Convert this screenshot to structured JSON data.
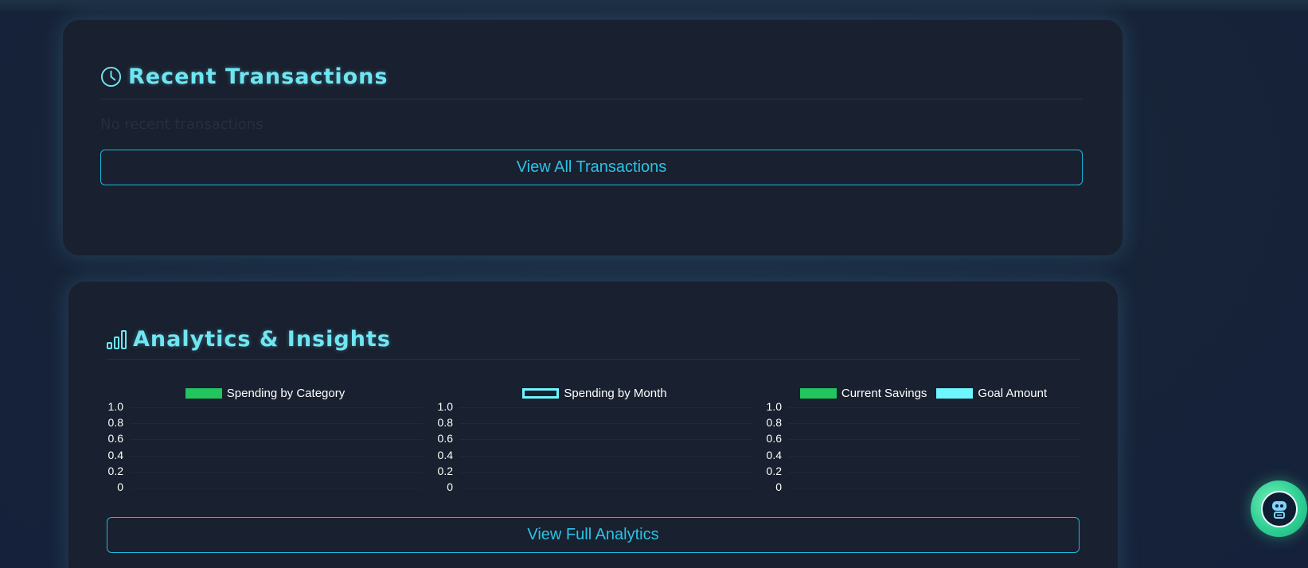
{
  "transactions": {
    "title": "Recent Transactions",
    "icon": "clock-icon",
    "empty_text": "No recent transactions",
    "view_all_label": "View All Transactions"
  },
  "analytics": {
    "title": "Analytics & Insights",
    "icon": "bar-chart-icon",
    "view_full_label": "View Full Analytics"
  },
  "colors": {
    "accent_title": "#6fe6f2",
    "button_border": "#1fb8d8",
    "green": "#22c55e",
    "cyan": "#6ef6ff"
  },
  "chart_data": [
    {
      "type": "bar",
      "series": [
        {
          "name": "Spending by Category",
          "values": []
        }
      ],
      "categories": [],
      "yticks": [
        "1.0",
        "0.8",
        "0.6",
        "0.4",
        "0.2",
        "0"
      ],
      "ylim": [
        0,
        1
      ],
      "legend": "top-center"
    },
    {
      "type": "line",
      "series": [
        {
          "name": "Spending by Month",
          "values": []
        }
      ],
      "categories": [],
      "yticks": [
        "1.0",
        "0.8",
        "0.6",
        "0.4",
        "0.2",
        "0"
      ],
      "ylim": [
        0,
        1
      ],
      "legend": "top-center"
    },
    {
      "type": "bar",
      "series": [
        {
          "name": "Current Savings",
          "values": []
        },
        {
          "name": "Goal Amount",
          "values": []
        }
      ],
      "categories": [],
      "yticks": [
        "1.0",
        "0.8",
        "0.6",
        "0.4",
        "0.2",
        "0"
      ],
      "ylim": [
        0,
        1
      ],
      "legend": "top-center"
    }
  ],
  "assistant": {
    "icon": "robot-icon"
  }
}
